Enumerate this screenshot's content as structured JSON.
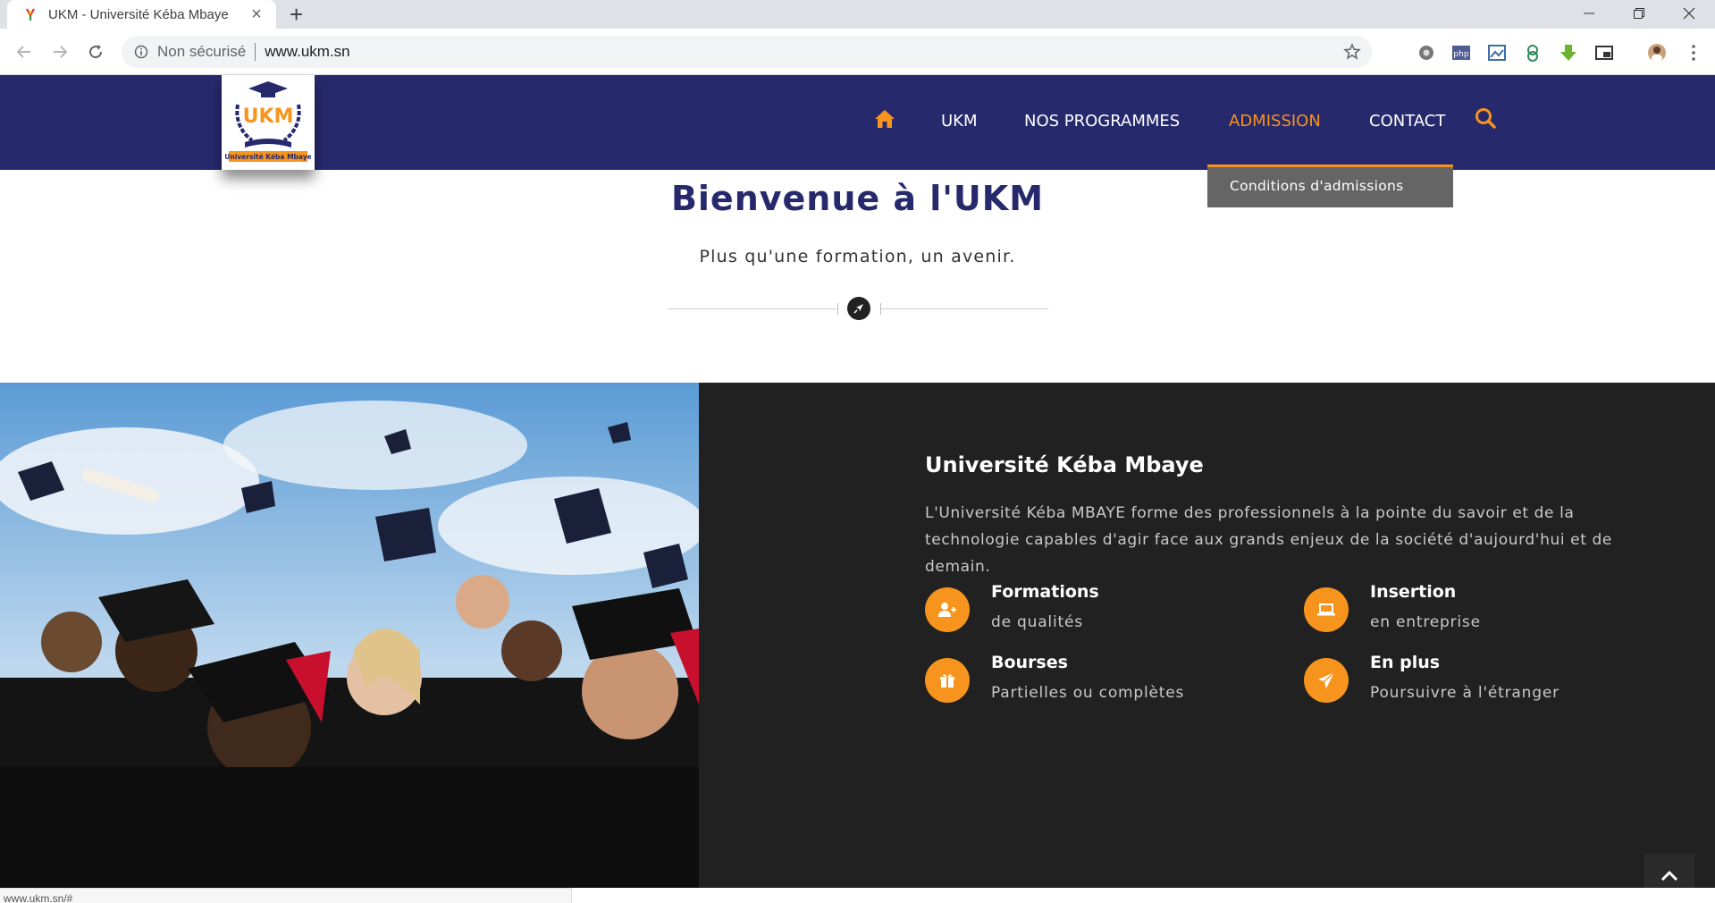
{
  "browser": {
    "tab_title": "UKM - Université Kéba Mbaye",
    "security_label": "Non sécurisé",
    "url": "www.ukm.sn",
    "extensions": [
      "chrome-ext-icon",
      "php-ext-icon",
      "image-ext-icon",
      "bookmark-ext-icon",
      "download-ext-icon",
      "cast-ext-icon"
    ],
    "status_url": "www.ukm.sn/#"
  },
  "site": {
    "logo_text": "UKM",
    "logo_caption": "Université Kéba Mbaye",
    "nav": {
      "items": [
        "UKM",
        "NOS PROGRAMMES",
        "ADMISSION",
        "CONTACT"
      ],
      "active": "ADMISSION"
    },
    "dropdown": {
      "items": [
        "Conditions d'admissions"
      ]
    },
    "colors": {
      "primary": "#27296d",
      "accent": "#f7941d",
      "panel": "#212121"
    }
  },
  "welcome": {
    "title": "Bienvenue à l'UKM",
    "subtitle": "Plus qu'une formation, un avenir."
  },
  "about": {
    "title": "Université Kéba Mbaye",
    "description": "L'Université Kéba MBAYE forme des professionnels à la pointe du savoir et de la technologie capables d'agir face aux grands enjeux de la société d'aujourd'hui et de demain.",
    "features": [
      {
        "title": "Formations",
        "subtitle": "de qualités",
        "icon": "user-plus-icon"
      },
      {
        "title": "Insertion",
        "subtitle": "en entreprise",
        "icon": "laptop-icon"
      },
      {
        "title": "Bourses",
        "subtitle": "Partielles ou complètes",
        "icon": "gift-icon"
      },
      {
        "title": "En plus",
        "subtitle": "Poursuivre à l'étranger",
        "icon": "paper-plane-icon"
      }
    ]
  }
}
